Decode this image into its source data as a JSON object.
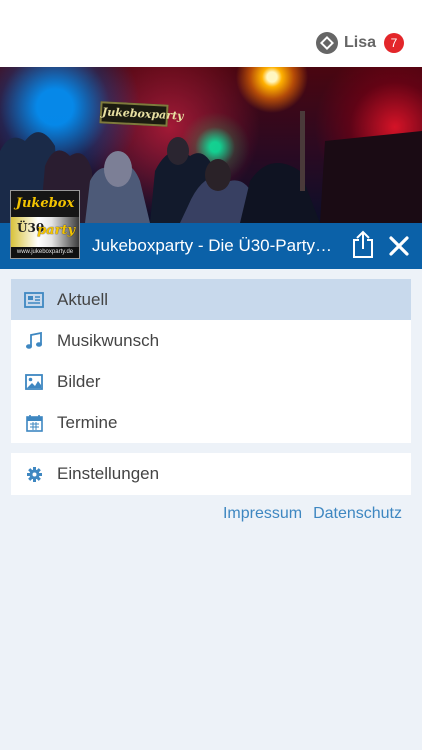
{
  "header": {
    "user_name": "Lisa",
    "notification_count": "7"
  },
  "banner": {
    "sign_text": "Jukeboxparty"
  },
  "logo": {
    "top_text": "Jukebox",
    "middle_left_text": "Ü30",
    "middle_right_text": "party",
    "bottom_text": "www.jukeboxparty.de"
  },
  "titlebar": {
    "title": "Jukeboxparty - Die Ü30-Party…"
  },
  "menu": {
    "items": [
      {
        "label": "Aktuell",
        "icon": "newspaper-icon",
        "active": true
      },
      {
        "label": "Musikwunsch",
        "icon": "music-note-icon",
        "active": false
      },
      {
        "label": "Bilder",
        "icon": "image-icon",
        "active": false
      },
      {
        "label": "Termine",
        "icon": "calendar-icon",
        "active": false
      }
    ]
  },
  "settings": {
    "label": "Einstellungen",
    "icon": "gear-icon"
  },
  "footer": {
    "impressum": "Impressum",
    "datenschutz": "Datenschutz"
  },
  "colors": {
    "header_blue": "#0b61a8",
    "active_row": "#c8d9ec",
    "icon_blue": "#3e87c1",
    "badge_red": "#e3262a",
    "background": "#edf2f8"
  }
}
